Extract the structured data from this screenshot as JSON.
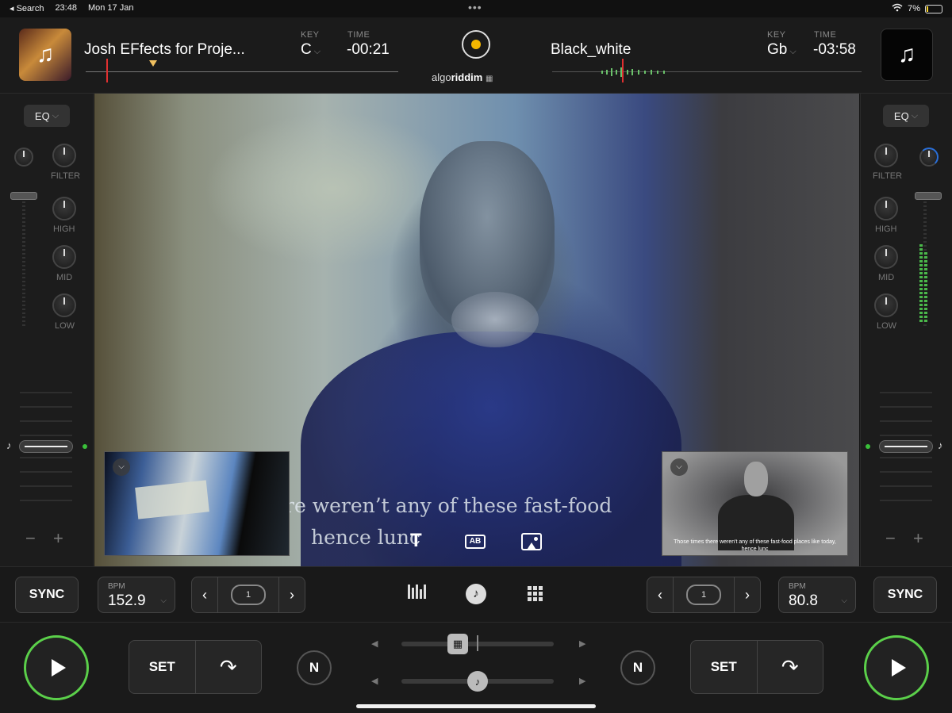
{
  "status": {
    "back_label": "◂ Search",
    "time": "23:48",
    "date": "Mon 17 Jan",
    "battery": "7%"
  },
  "deck_left": {
    "title": "Josh EFfects for Proje...",
    "key_label": "KEY",
    "key": "C",
    "time_label": "TIME",
    "time": "-00:21",
    "bpm_label": "BPM",
    "bpm": "152.9",
    "loop_count": "1",
    "sync": "SYNC",
    "set": "SET"
  },
  "deck_right": {
    "title": "Black_white",
    "key_label": "KEY",
    "key": "Gb",
    "time_label": "TIME",
    "time": "-03:58",
    "bpm_label": "BPM",
    "bpm": "80.8",
    "loop_count": "1",
    "sync": "SYNC",
    "set": "SET"
  },
  "brand": {
    "prefix": "algo",
    "suffix": "riddim"
  },
  "eq": {
    "button": "EQ",
    "filter": "FILTER",
    "high": "HIGH",
    "mid": "MID",
    "low": "LOW"
  },
  "video": {
    "subtitle_line1": "re weren’t any of these fast-food",
    "subtitle_line2": "hence lunc",
    "thumb_caption_line1": "Those times there weren't any of these fast-food places like today,",
    "thumb_caption_line2": "hence lunc"
  },
  "controls": {
    "nudge": "N"
  },
  "colors": {
    "play_ring": "#5bd04a",
    "accent_logo": "#f5b700",
    "playhead": "#e03030",
    "meter": "#4ab84a"
  },
  "icons": [
    "search-back",
    "wifi-icon",
    "battery-icon",
    "music-note-icon",
    "chevron-down-icon",
    "text-icon",
    "ab-subtitle-icon",
    "image-icon",
    "mixer-icon",
    "grid-icon",
    "loop-icon",
    "play-icon",
    "cue-arrow-icon",
    "film-icon"
  ]
}
